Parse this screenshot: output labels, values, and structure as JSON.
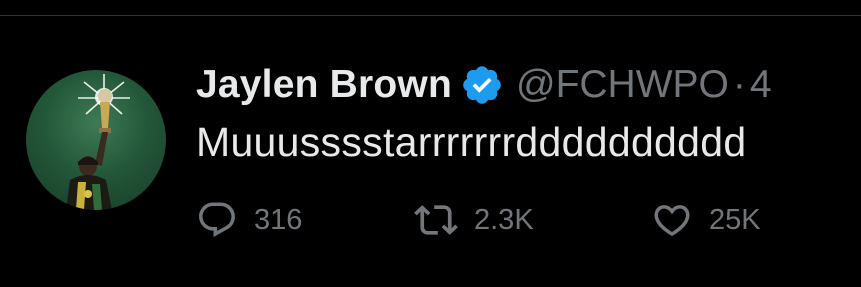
{
  "tweet": {
    "author": {
      "display_name": "Jaylen Brown",
      "handle": "@FCHWPO",
      "verified": true,
      "verified_color": "#1d9bf0"
    },
    "separator": "·",
    "timestamp": "4",
    "text": "Muuusssstarrrrrrrdddddddddd",
    "actions": {
      "reply": {
        "icon": "reply-icon",
        "count": "316"
      },
      "retweet": {
        "icon": "retweet-icon",
        "count": "2.3K"
      },
      "like": {
        "icon": "heart-icon",
        "count": "25K"
      }
    }
  },
  "colors": {
    "background": "#000000",
    "primary_text": "#e7e9ea",
    "secondary_text": "#71767b",
    "verified_blue": "#1d9bf0",
    "avatar_green": "#24583a"
  }
}
